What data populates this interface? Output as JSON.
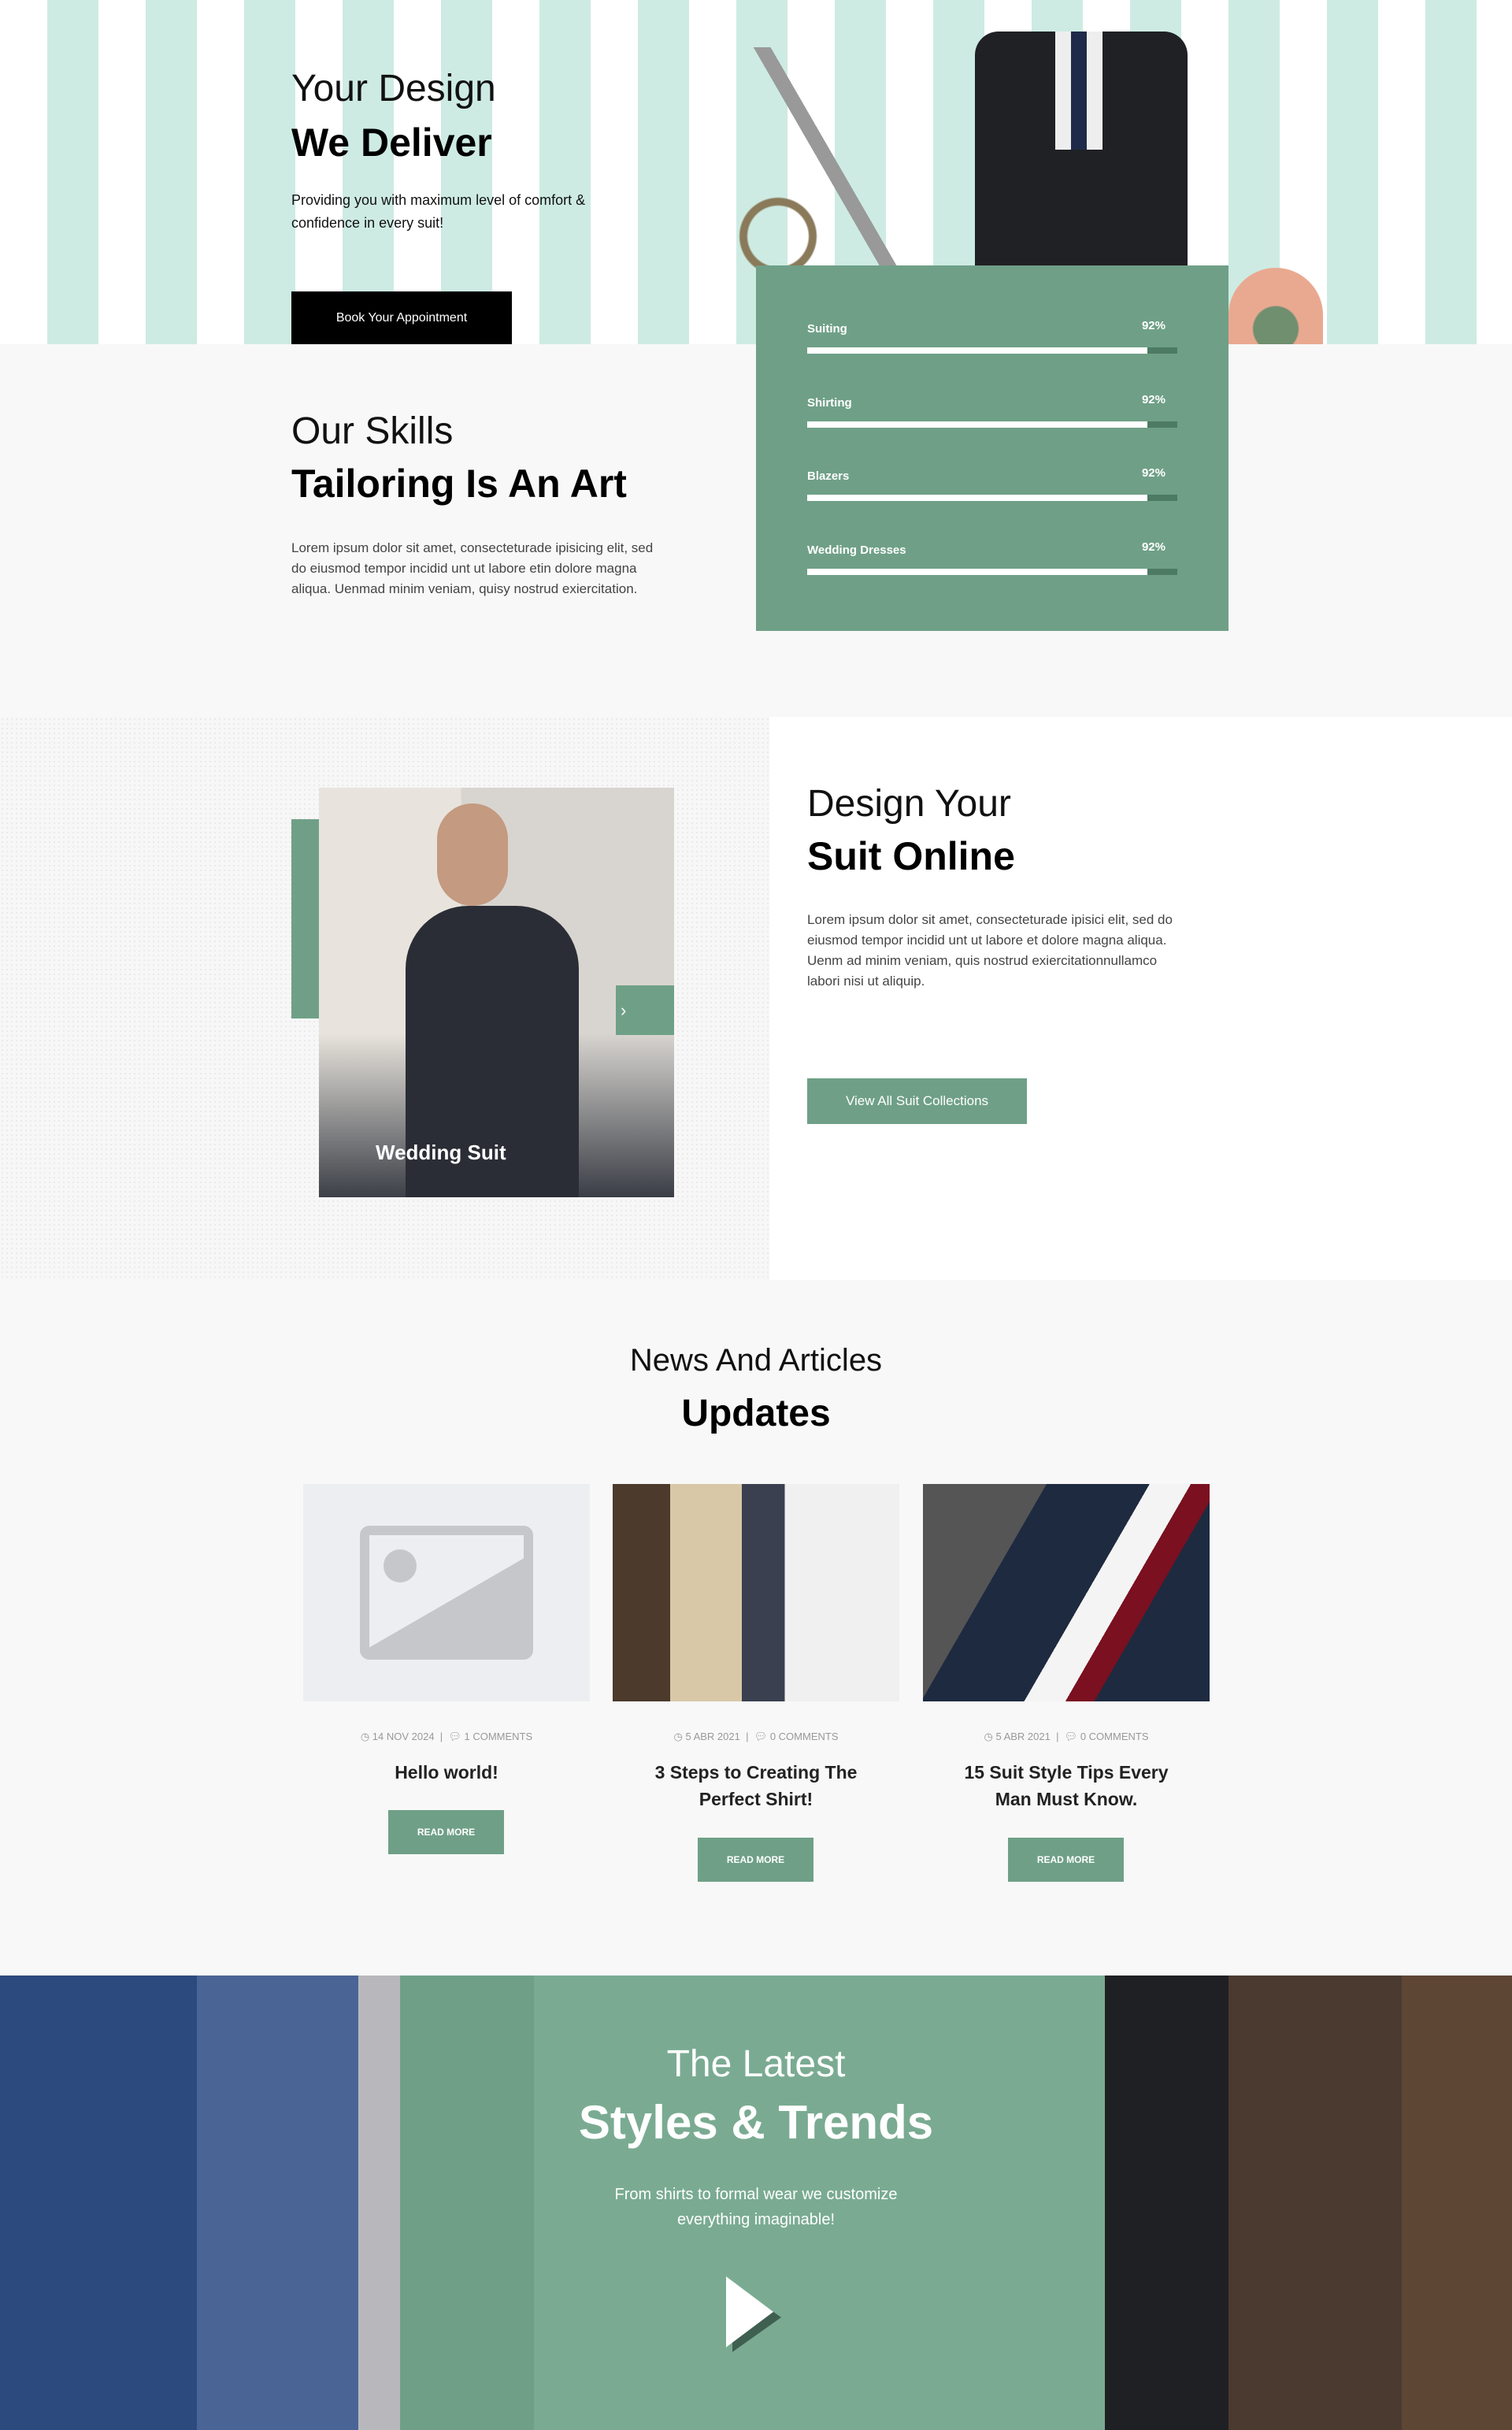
{
  "hero": {
    "title_light": "Your Design",
    "title_bold": "We Deliver",
    "text": "Providing you with maximum level of comfort & confidence in every suit!",
    "button": "Book Your Appointment"
  },
  "skills": {
    "title_light": "Our Skills",
    "title_bold": "Tailoring Is An Art",
    "text": "Lorem ipsum dolor sit amet, consecteturade ipisicing elit, sed do eiusmod tempor incidid unt ut labore etin dolore magna aliqua. Uenmad minim veniam, quisy nostrud exiercitation.",
    "items": [
      {
        "label": "Suiting",
        "value": "92%",
        "percent": 92
      },
      {
        "label": "Shirting",
        "value": "92%",
        "percent": 92
      },
      {
        "label": "Blazers",
        "value": "92%",
        "percent": 92
      },
      {
        "label": "Wedding Dresses",
        "value": "92%",
        "percent": 92
      }
    ]
  },
  "suit": {
    "slide_caption": "Wedding Suit",
    "title_light": "Design Your",
    "title_bold": "Suit Online",
    "text": "Lorem ipsum dolor sit amet, consecteturade ipisici elit, sed do eiusmod tempor incidid unt ut labore et dolore magna aliqua. Uenm ad minim veniam, quis nostrud exiercitationnullamco labori nisi ut aliquip.",
    "button": "View All Suit Collections"
  },
  "news": {
    "title_light": "News And Articles",
    "title_bold": "Updates",
    "posts": [
      {
        "date": "14 Nov 2024",
        "comments": "1 Comments",
        "title": "Hello world!",
        "button": "Read More"
      },
      {
        "date": "5 Abr 2021",
        "comments": "0 Comments",
        "title": "3 Steps to Creating The Perfect Shirt!",
        "button": "Read More"
      },
      {
        "date": "5 Abr 2021",
        "comments": "0 Comments",
        "title": "15 Suit Style Tips Every Man Must Know.",
        "button": "Read More"
      }
    ]
  },
  "trends": {
    "title_light": "The Latest",
    "title_bold": "Styles & Trends",
    "text": "From shirts to formal wear we customize everything imaginable!"
  },
  "colors": {
    "accent": "#6fa087",
    "dark": "#000000"
  }
}
